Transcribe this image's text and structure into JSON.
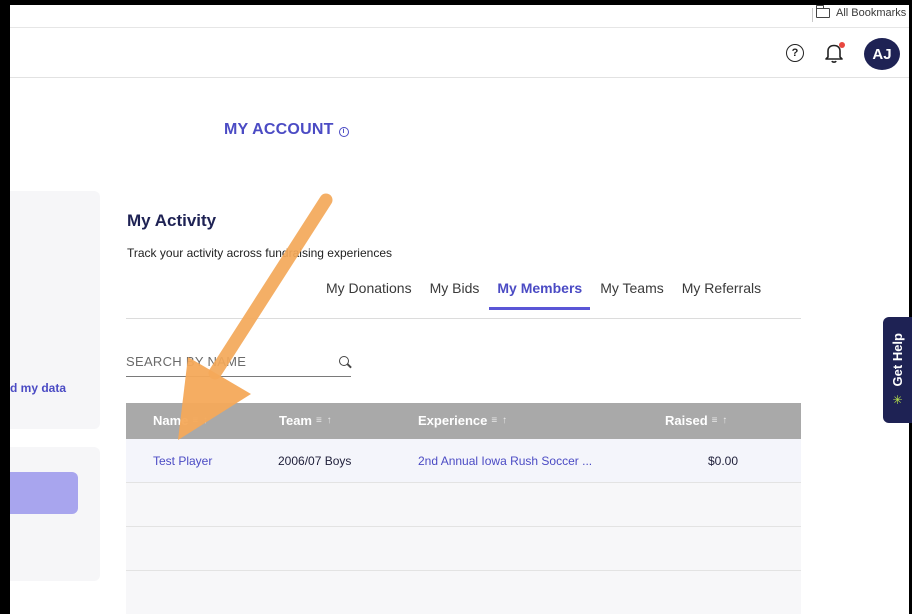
{
  "browser": {
    "bookmarks_label": "All Bookmarks",
    "bookmarks_icon": "folder-icon"
  },
  "header": {
    "help_icon": "question-icon",
    "help_glyph": "?",
    "notifications_icon": "bell-icon",
    "avatar_initials": "AJ"
  },
  "page": {
    "title": "MY ACCOUNT",
    "info_glyph": "i"
  },
  "left": {
    "link_text": "d my data"
  },
  "activity": {
    "title": "My Activity",
    "subtitle": "Track your activity across fundraising experiences",
    "tabs": [
      {
        "label": "My Donations",
        "active": false
      },
      {
        "label": "My Bids",
        "active": false
      },
      {
        "label": "My Members",
        "active": true
      },
      {
        "label": "My Teams",
        "active": false
      },
      {
        "label": "My Referrals",
        "active": false
      }
    ],
    "search_placeholder": "SEARCH BY NAME",
    "table": {
      "columns": [
        "Name",
        "Team",
        "Experience",
        "Raised"
      ],
      "sort_glyph": "≡ ↑",
      "rows": [
        {
          "name": "Test Player",
          "team": "2006/07 Boys",
          "experience": "2nd Annual Iowa Rush Soccer ...",
          "raised": "$0.00"
        }
      ]
    }
  },
  "widget": {
    "label": "Get Help",
    "icon": "sparkle-icon",
    "glyph": "✳"
  },
  "colors": {
    "accent": "#4b4bc4",
    "navy": "#1e2254",
    "annotation_arrow": "#f4a95a"
  }
}
